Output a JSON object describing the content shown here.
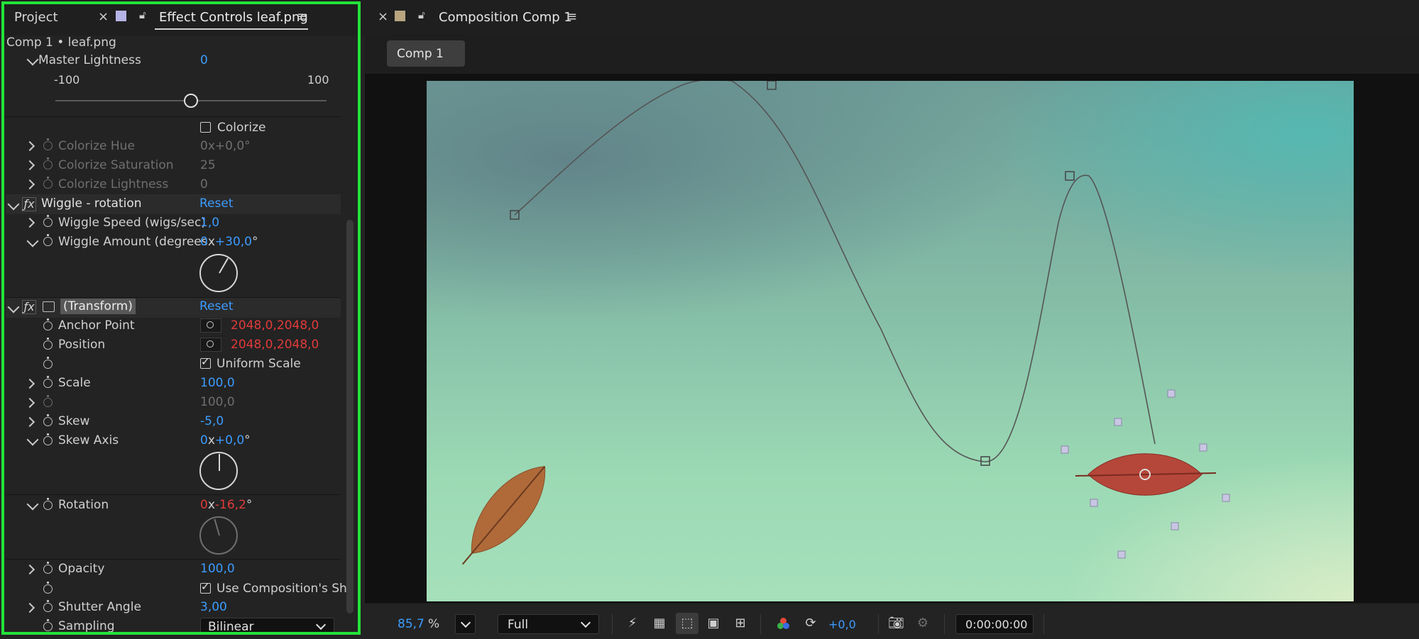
{
  "left_panel": {
    "tab_project": "Project",
    "tab_effect_controls": "Effect Controls leaf.png",
    "layer_path": "Comp 1 • leaf.png",
    "master_lightness": {
      "label": "Master Lightness",
      "value": "0",
      "min_label": "-100",
      "max_label": "100",
      "slider_value": 0
    },
    "colorize": {
      "label": "Colorize",
      "checked": false
    },
    "colorize_hue": {
      "label": "Colorize Hue",
      "value": "0x+0,0°"
    },
    "colorize_saturation": {
      "label": "Colorize Saturation",
      "value": "25"
    },
    "colorize_lightness": {
      "label": "Colorize Lightness",
      "value": "0"
    },
    "wiggle": {
      "name": "Wiggle - rotation",
      "reset": "Reset",
      "speed_label": "Wiggle Speed (wigs/sec)",
      "speed_value": "1,0",
      "amount_label": "Wiggle Amount (degrees",
      "amount_rev": "0",
      "amount_x": "x",
      "amount_angle": "+30,0",
      "amount_deg": "°"
    },
    "transform": {
      "name": "(Transform)",
      "reset": "Reset",
      "anchor_label": "Anchor Point",
      "anchor_x": "2048,0",
      "anchor_sep": ",",
      "anchor_y": "2048,0",
      "position_label": "Position",
      "position_x": "2048,0",
      "position_sep": ",",
      "position_y": "2048,0",
      "uniform_scale_label": "Uniform Scale",
      "scale_label": "Scale",
      "scale_value": "100,0",
      "scale_height_value": "100,0",
      "skew_label": "Skew",
      "skew_value": "-5,0",
      "skew_axis_label": "Skew Axis",
      "skew_axis_rev": "0",
      "skew_axis_x": "x",
      "skew_axis_angle": "+0,0",
      "skew_axis_deg": "°",
      "rotation_label": "Rotation",
      "rotation_rev": "0",
      "rotation_x": "x",
      "rotation_angle": "-16,2",
      "rotation_deg": "°",
      "opacity_label": "Opacity",
      "opacity_value": "100,0",
      "use_comp_shutter_label": "Use Composition's Sh",
      "shutter_angle_label": "Shutter Angle",
      "shutter_angle_value": "3,00",
      "sampling_label": "Sampling",
      "sampling_value": "Bilinear"
    }
  },
  "right_panel": {
    "tab_title": "Composition Comp 1",
    "subtab": "Comp 1",
    "zoom_value": "85,7",
    "zoom_unit": "%",
    "resolution": "Full",
    "exposure": "+0,0",
    "timecode": "0:00:00:00"
  },
  "colors": {
    "accent_blue": "#3c9cff",
    "keyframed_red": "#e23a3a",
    "highlight_green": "#23e23a"
  }
}
